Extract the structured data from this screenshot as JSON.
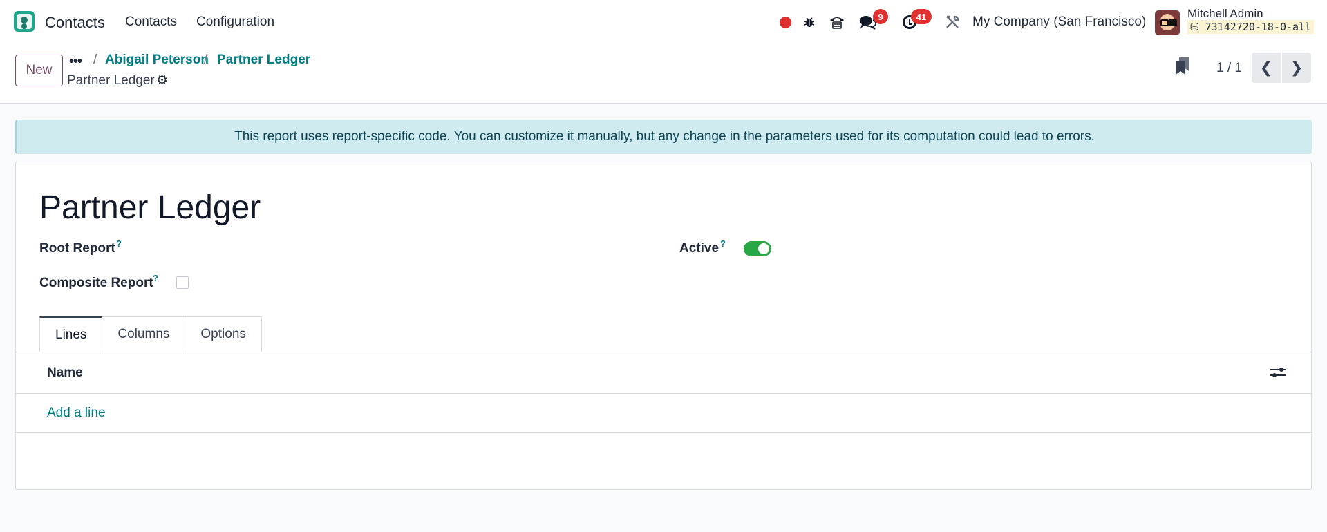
{
  "navbar": {
    "app_name": "Contacts",
    "menus": [
      "Contacts",
      "Configuration"
    ],
    "message_count": "9",
    "activity_count": "41",
    "company": "My Company (San Francisco)",
    "user_name": "Mitchell Admin",
    "database": "73142720-18-0-all",
    "icons": [
      "recording-dot-icon",
      "bug-icon",
      "phone-icon",
      "chat-icon",
      "clock-icon",
      "tools-icon"
    ]
  },
  "control_panel": {
    "new_label": "New",
    "breadcrumbs": [
      "Abigail Peterson",
      "Partner Ledger"
    ],
    "separator": "/",
    "record_title": "Partner Ledger",
    "pager": "1 / 1"
  },
  "alert": {
    "text": "This report uses report-specific code. You can customize it manually, but any change in the parameters used for its computation could lead to errors."
  },
  "form": {
    "title": "Partner Ledger",
    "root_report_label": "Root Report",
    "composite_report_label": "Composite Report",
    "composite_report_checked": false,
    "active_label": "Active",
    "active_value": true,
    "help_mark": "?",
    "tabs": [
      "Lines",
      "Columns",
      "Options"
    ],
    "active_tab": "Lines",
    "lines": {
      "column_name": "Name",
      "add_line_label": "Add a line"
    }
  },
  "colors": {
    "link": "#017e84",
    "primary": "#714b67",
    "alert_bg": "#d0ebf0",
    "toggle_on": "#28a745",
    "badge": "#e03131"
  }
}
